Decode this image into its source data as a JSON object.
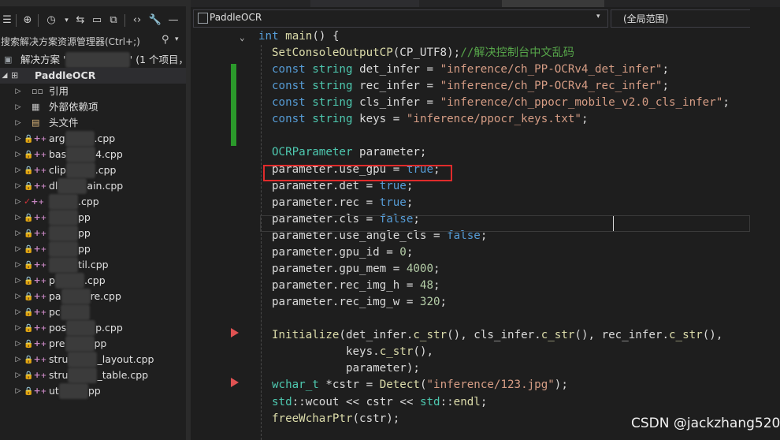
{
  "solution_explorer": {
    "toolbar": [
      "☰",
      "⊕",
      "◷",
      "⇆",
      "▭",
      "⧉",
      "‹›",
      "🔧",
      "—"
    ],
    "search_placeholder": "搜索解决方案资源管理器(Ctrl+;)",
    "solution_label": "解决方案 '",
    "solution_suffix": "' (1 个项目，共",
    "project": "PaddleOCR",
    "items": [
      {
        "label": "引用",
        "kind": "ref"
      },
      {
        "label": "外部依赖项",
        "kind": "ext"
      },
      {
        "label": "头文件",
        "kind": "folder"
      },
      {
        "label": "args.cpp",
        "kind": "file",
        "pre": "arg",
        "suf": ".cpp"
      },
      {
        "label": "base64.cpp",
        "kind": "file",
        "pre": "bas",
        "suf": "4.cpp"
      },
      {
        "label": "clipper.cpp",
        "kind": "file",
        "pre": "clip",
        "suf": ".cpp"
      },
      {
        "label": "dllmain.cpp",
        "kind": "file",
        "pre": "dl",
        "suf": "ain.cpp"
      },
      {
        "label": "paddleocr.cpp",
        "kind": "file-changed",
        "pre": "",
        "suf": ".cpp"
      },
      {
        "label": "ocr_cls.cpp",
        "kind": "file",
        "pre": "",
        "suf": "pp"
      },
      {
        "label": "ocr_det.cpp",
        "kind": "file",
        "pre": "",
        "suf": "pp"
      },
      {
        "label": "ocr_rec.cpp",
        "kind": "file",
        "pre": "",
        "suf": "pp"
      },
      {
        "label": "paddleocr_util.cpp",
        "kind": "file",
        "pre": "",
        "suf": "til.cpp"
      },
      {
        "label": "paddleocr.cpp",
        "kind": "file",
        "pre": "p",
        "suf": ".cpp"
      },
      {
        "label": "paddlestructure.cpp",
        "kind": "file",
        "pre": "pa",
        "suf": "re.cpp"
      },
      {
        "label": "pch.cpp",
        "kind": "file",
        "pre": "pc",
        "suf": ""
      },
      {
        "label": "postprocess_op.cpp",
        "kind": "file",
        "pre": "pos",
        "suf": "p.cpp"
      },
      {
        "label": "preprocess_op.cpp",
        "kind": "file",
        "pre": "pre",
        "suf": "pp"
      },
      {
        "label": "structure_layout.cpp",
        "kind": "file",
        "pre": "stru",
        "suf": "_layout.cpp"
      },
      {
        "label": "structure_table.cpp",
        "kind": "file",
        "pre": "stru",
        "suf": "_table.cpp"
      },
      {
        "label": "utility.cpp",
        "kind": "file",
        "pre": "ut",
        "suf": "pp"
      }
    ]
  },
  "editor": {
    "file_combo": "PaddleOCR",
    "scope_combo": "(全局范围)",
    "code": [
      [
        [
          "kw",
          "int"
        ],
        [
          "pl",
          " "
        ],
        [
          "fn",
          "main"
        ],
        [
          "pl",
          "() {"
        ]
      ],
      [
        [
          "fn",
          "SetConsoleOutputCP"
        ],
        [
          "pl",
          "("
        ],
        [
          "mm",
          "CP_UTF8"
        ],
        [
          "pl",
          ");"
        ],
        [
          "cm",
          "//解决控制台中文乱码"
        ]
      ],
      [
        [
          "kw",
          "const"
        ],
        [
          "pl",
          " "
        ],
        [
          "ty",
          "string"
        ],
        [
          "pl",
          " "
        ],
        [
          "id",
          "det_infer"
        ],
        [
          "pl",
          " = "
        ],
        [
          "st",
          "\"inference/ch_PP-OCRv4_det_infer\""
        ],
        [
          "pl",
          ";"
        ]
      ],
      [
        [
          "kw",
          "const"
        ],
        [
          "pl",
          " "
        ],
        [
          "ty",
          "string"
        ],
        [
          "pl",
          " "
        ],
        [
          "id",
          "rec_infer"
        ],
        [
          "pl",
          " = "
        ],
        [
          "st",
          "\"inference/ch_PP-OCRv4_rec_infer\""
        ],
        [
          "pl",
          ";"
        ]
      ],
      [
        [
          "kw",
          "const"
        ],
        [
          "pl",
          " "
        ],
        [
          "ty",
          "string"
        ],
        [
          "pl",
          " "
        ],
        [
          "id",
          "cls_infer"
        ],
        [
          "pl",
          " = "
        ],
        [
          "st",
          "\"inference/ch_ppocr_mobile_v2.0_cls_infer\""
        ],
        [
          "pl",
          ";"
        ]
      ],
      [
        [
          "kw",
          "const"
        ],
        [
          "pl",
          " "
        ],
        [
          "ty",
          "string"
        ],
        [
          "pl",
          " "
        ],
        [
          "id",
          "keys"
        ],
        [
          "pl",
          " = "
        ],
        [
          "st",
          "\"inference/ppocr_keys.txt\""
        ],
        [
          "pl",
          ";"
        ]
      ],
      [],
      [
        [
          "ty",
          "OCRParameter"
        ],
        [
          "pl",
          " "
        ],
        [
          "id",
          "parameter"
        ],
        [
          "pl",
          ";"
        ]
      ],
      [
        [
          "id",
          "parameter"
        ],
        [
          "pl",
          "."
        ],
        [
          "id",
          "use_gpu"
        ],
        [
          "pl",
          " = "
        ],
        [
          "kw",
          "true"
        ],
        [
          "pl",
          ";"
        ]
      ],
      [
        [
          "id",
          "parameter"
        ],
        [
          "pl",
          "."
        ],
        [
          "id",
          "det"
        ],
        [
          "pl",
          " = "
        ],
        [
          "kw",
          "true"
        ],
        [
          "pl",
          ";"
        ]
      ],
      [
        [
          "id",
          "parameter"
        ],
        [
          "pl",
          "."
        ],
        [
          "id",
          "rec"
        ],
        [
          "pl",
          " = "
        ],
        [
          "kw",
          "true"
        ],
        [
          "pl",
          ";"
        ]
      ],
      [
        [
          "id",
          "parameter"
        ],
        [
          "pl",
          "."
        ],
        [
          "id",
          "cls"
        ],
        [
          "pl",
          " = "
        ],
        [
          "kw",
          "false"
        ],
        [
          "pl",
          ";"
        ]
      ],
      [
        [
          "id",
          "parameter"
        ],
        [
          "pl",
          "."
        ],
        [
          "id",
          "use_angle_cls"
        ],
        [
          "pl",
          " = "
        ],
        [
          "kw",
          "false"
        ],
        [
          "pl",
          ";"
        ]
      ],
      [
        [
          "id",
          "parameter"
        ],
        [
          "pl",
          "."
        ],
        [
          "id",
          "gpu_id"
        ],
        [
          "pl",
          " = "
        ],
        [
          "nu",
          "0"
        ],
        [
          "pl",
          ";"
        ]
      ],
      [
        [
          "id",
          "parameter"
        ],
        [
          "pl",
          "."
        ],
        [
          "id",
          "gpu_mem"
        ],
        [
          "pl",
          " = "
        ],
        [
          "nu",
          "4000"
        ],
        [
          "pl",
          ";"
        ]
      ],
      [
        [
          "id",
          "parameter"
        ],
        [
          "pl",
          "."
        ],
        [
          "id",
          "rec_img_h"
        ],
        [
          "pl",
          " = "
        ],
        [
          "nu",
          "48"
        ],
        [
          "pl",
          ";"
        ]
      ],
      [
        [
          "id",
          "parameter"
        ],
        [
          "pl",
          "."
        ],
        [
          "id",
          "rec_img_w"
        ],
        [
          "pl",
          " = "
        ],
        [
          "nu",
          "320"
        ],
        [
          "pl",
          ";"
        ]
      ],
      [],
      [
        [
          "fn",
          "Initialize"
        ],
        [
          "pl",
          "("
        ],
        [
          "id",
          "det_infer"
        ],
        [
          "pl",
          "."
        ],
        [
          "fn",
          "c_str"
        ],
        [
          "pl",
          "(), "
        ],
        [
          "id",
          "cls_infer"
        ],
        [
          "pl",
          "."
        ],
        [
          "fn",
          "c_str"
        ],
        [
          "pl",
          "(), "
        ],
        [
          "id",
          "rec_infer"
        ],
        [
          "pl",
          "."
        ],
        [
          "fn",
          "c_str"
        ],
        [
          "pl",
          "(),"
        ]
      ],
      [
        [
          "pl",
          "           "
        ],
        [
          "id",
          "keys"
        ],
        [
          "pl",
          "."
        ],
        [
          "fn",
          "c_str"
        ],
        [
          "pl",
          "(),"
        ]
      ],
      [
        [
          "pl",
          "           "
        ],
        [
          "id",
          "parameter"
        ],
        [
          "pl",
          ");"
        ]
      ],
      [
        [
          "ty",
          "wchar_t"
        ],
        [
          "pl",
          " *"
        ],
        [
          "id",
          "cstr"
        ],
        [
          "pl",
          " = "
        ],
        [
          "fn",
          "Detect"
        ],
        [
          "pl",
          "("
        ],
        [
          "st",
          "\"inference/123.jpg\""
        ],
        [
          "pl",
          ");"
        ]
      ],
      [
        [
          "ty",
          "std"
        ],
        [
          "pl",
          "::"
        ],
        [
          "id",
          "wcout"
        ],
        [
          "pl",
          " << "
        ],
        [
          "id",
          "cstr"
        ],
        [
          "pl",
          " << "
        ],
        [
          "ty",
          "std"
        ],
        [
          "pl",
          "::"
        ],
        [
          "fn",
          "endl"
        ],
        [
          "pl",
          ";"
        ]
      ],
      [
        [
          "fn",
          "freeWcharPtr"
        ],
        [
          "pl",
          "("
        ],
        [
          "id",
          "cstr"
        ],
        [
          "pl",
          ");"
        ]
      ]
    ]
  },
  "watermark": "CSDN @jackzhang520",
  "colors": {
    "highlight_box": "#e02b2b",
    "breakpoint": "#e05252",
    "change_bar": "#2b9a2b"
  }
}
